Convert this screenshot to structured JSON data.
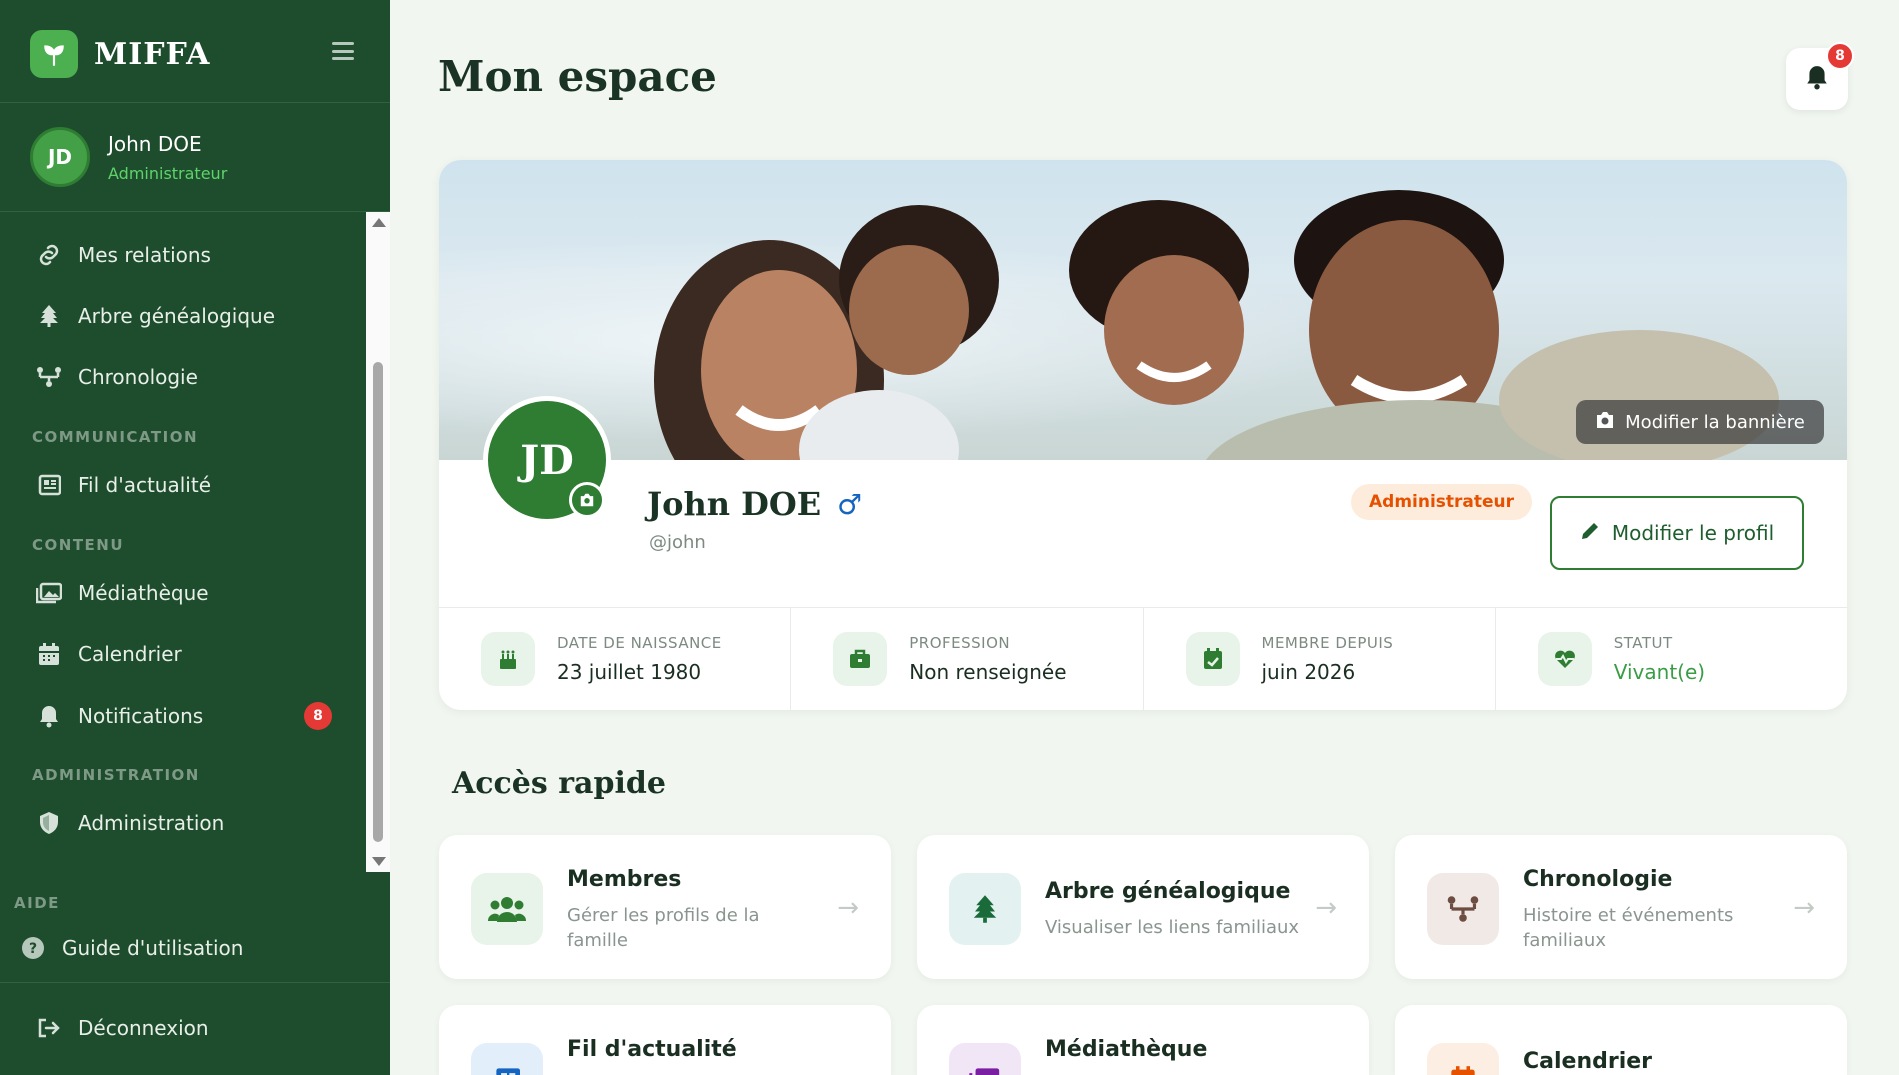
{
  "brand": {
    "name": "MIFFA"
  },
  "user": {
    "initials": "JD",
    "name": "John DOE",
    "role": "Administrateur"
  },
  "nav": {
    "items": [
      {
        "label": "Mes relations",
        "icon": "link-icon"
      },
      {
        "label": "Arbre généalogique",
        "icon": "tree-icon"
      },
      {
        "label": "Chronologie",
        "icon": "timeline-icon"
      }
    ],
    "communication_label": "COMMUNICATION",
    "communication": [
      {
        "label": "Fil d'actualité",
        "icon": "newspaper-icon"
      }
    ],
    "contenu_label": "CONTENU",
    "contenu": [
      {
        "label": "Médiathèque",
        "icon": "images-icon"
      },
      {
        "label": "Calendrier",
        "icon": "calendar-icon"
      },
      {
        "label": "Notifications",
        "icon": "bell-icon",
        "badge": "8"
      }
    ],
    "administration_label": "ADMINISTRATION",
    "administration": [
      {
        "label": "Administration",
        "icon": "shield-icon"
      }
    ],
    "aide_label": "AIDE",
    "guide": "Guide d'utilisation",
    "logout": "Déconnexion"
  },
  "header": {
    "title": "Mon espace",
    "notif_count": "8"
  },
  "profile": {
    "banner_button": "Modifier la bannière",
    "initials": "JD",
    "name": "John DOE",
    "gender_symbol": "♂",
    "handle": "@john",
    "role": "Administrateur",
    "edit_button": "Modifier le profil",
    "stats": [
      {
        "label": "DATE DE NAISSANCE",
        "value": "23 juillet 1980",
        "icon": "birthday-cake-icon"
      },
      {
        "label": "PROFESSION",
        "value": "Non renseignée",
        "icon": "briefcase-icon"
      },
      {
        "label": "MEMBRE DEPUIS",
        "value": "juin 2026",
        "icon": "calendar-check-icon"
      },
      {
        "label": "STATUT",
        "value": "Vivant(e)",
        "icon": "heartbeat-icon"
      }
    ]
  },
  "quick": {
    "title": "Accès rapide",
    "cards": [
      {
        "title": "Membres",
        "desc": "Gérer les profils de la famille",
        "icon": "users-icon",
        "bg": "#e8f3ea",
        "color": "#2e7d32"
      },
      {
        "title": "Arbre généalogique",
        "desc": "Visualiser les liens familiaux",
        "icon": "tree-icon",
        "bg": "#e3f2f0",
        "color": "#1b6b3a"
      },
      {
        "title": "Chronologie",
        "desc": "Histoire et événements familiaux",
        "icon": "timeline-icon",
        "bg": "#f1e9e6",
        "color": "#6d4c41"
      },
      {
        "title": "Fil d'actualité",
        "desc": "",
        "icon": "newspaper-icon",
        "bg": "#e3eefb",
        "color": "#1565c0"
      },
      {
        "title": "Médiathèque",
        "desc": "",
        "icon": "images-icon",
        "bg": "#f1e6f5",
        "color": "#7b1fa2"
      },
      {
        "title": "Calendrier",
        "desc": "",
        "icon": "calendar-icon",
        "bg": "#fdeee3",
        "color": "#e65100"
      }
    ]
  }
}
